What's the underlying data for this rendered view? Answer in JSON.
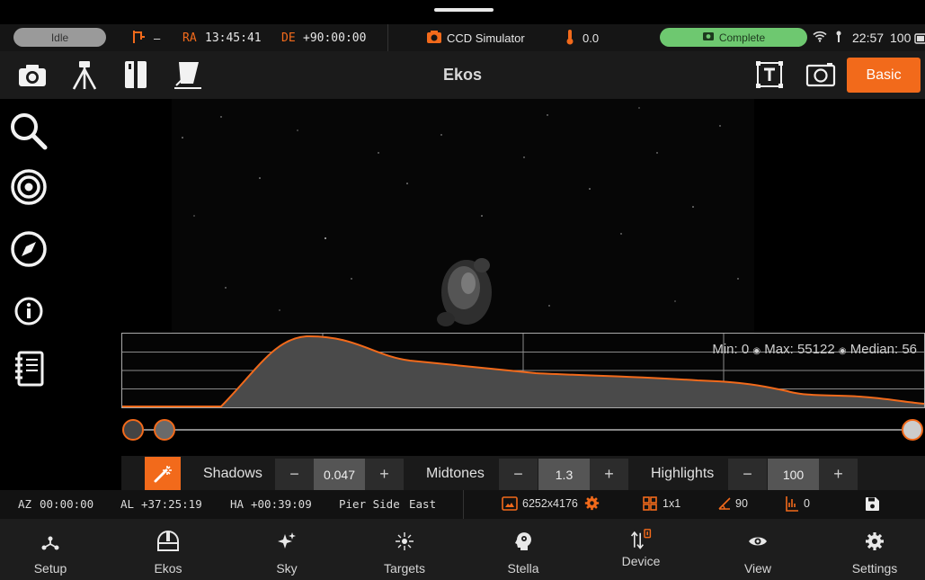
{
  "status": {
    "state": "Idle",
    "tracking_value": "–",
    "ra_label": "RA",
    "ra_value": "13:45:41",
    "de_label": "DE",
    "de_value": "+90:00:00",
    "camera_name": "CCD Simulator",
    "temperature": "0.0",
    "capture_state": "Complete",
    "clock": "22:57",
    "battery": "100"
  },
  "toolbar": {
    "title": "Ekos",
    "mode_button": "Basic"
  },
  "histogram": {
    "min_label": "Min:",
    "min_value": "0",
    "max_label": "Max:",
    "max_value": "55122",
    "median_label": "Median:",
    "median_value": "56"
  },
  "stretch": {
    "shadows_label": "Shadows",
    "shadows_value": "0.047",
    "midtones_label": "Midtones",
    "midtones_value": "1.3",
    "highlights_label": "Highlights",
    "highlights_value": "100",
    "minus": "−",
    "plus": "+"
  },
  "info": {
    "az_label": "AZ",
    "az_value": "00:00:00",
    "al_label": "AL",
    "al_value": "+37:25:19",
    "ha_label": "HA",
    "ha_value": "+00:39:09",
    "pier_label": "Pier Side",
    "pier_value": "East",
    "resolution": "6252x4176",
    "binning": "1x1",
    "rotation": "90",
    "offset": "0"
  },
  "nav": [
    {
      "label": "Setup",
      "icon": "setup-icon"
    },
    {
      "label": "Ekos",
      "icon": "observatory-icon"
    },
    {
      "label": "Sky",
      "icon": "sparkle-icon"
    },
    {
      "label": "Targets",
      "icon": "target-icon"
    },
    {
      "label": "Stella",
      "icon": "stella-head-icon"
    },
    {
      "label": "Device",
      "icon": "device-icon"
    },
    {
      "label": "View",
      "icon": "eye-icon"
    },
    {
      "label": "Settings",
      "icon": "gear-icon"
    }
  ],
  "colors": {
    "accent": "#f26a1b",
    "complete": "#6ec870",
    "idle": "#9a9a9a"
  }
}
